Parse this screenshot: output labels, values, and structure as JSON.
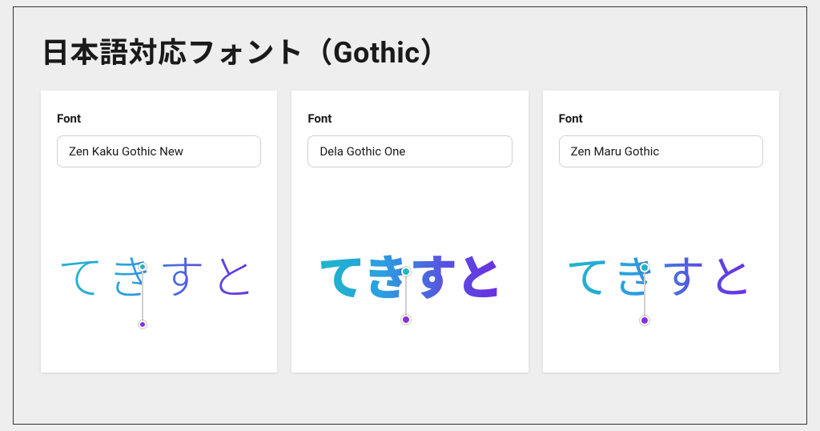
{
  "title": "日本語対応フォント（Gothic）",
  "field_label": "Font",
  "sample_text": "てきすと",
  "cards": [
    {
      "font_name": "Zen Kaku Gothic New",
      "style": "light"
    },
    {
      "font_name": "Dela Gothic One",
      "style": "bold"
    },
    {
      "font_name": "Zen Maru Gothic",
      "style": "round"
    }
  ]
}
